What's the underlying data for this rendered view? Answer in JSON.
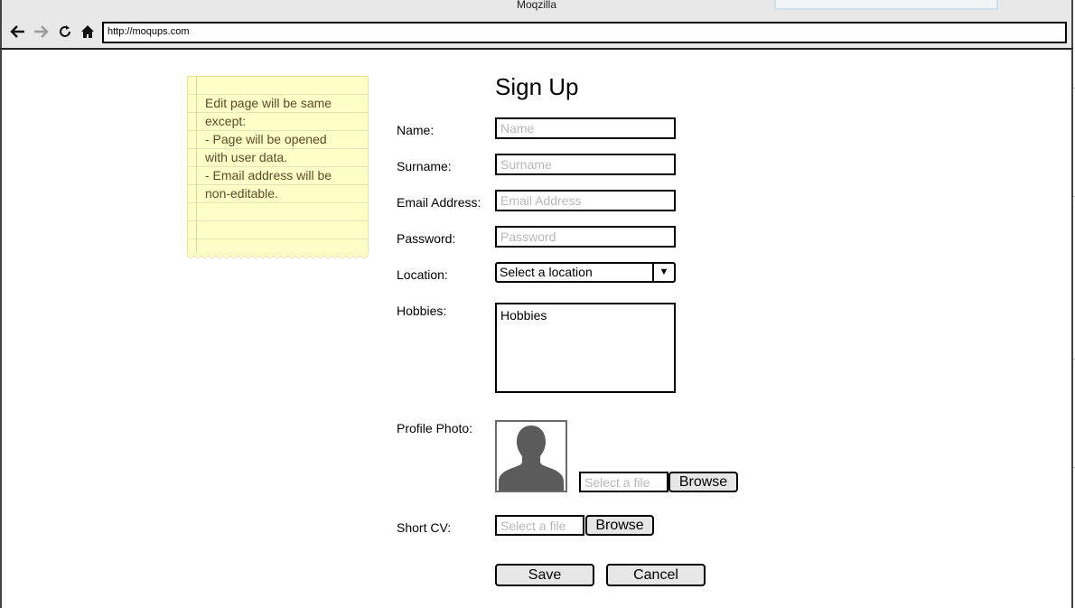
{
  "browser": {
    "window_title": "Moqzilla",
    "url": "http://moqups.com",
    "nav_icons": [
      "back-arrow-icon",
      "forward-arrow-icon",
      "reload-icon",
      "home-icon"
    ]
  },
  "note": {
    "lines": [
      "Edit page will be same",
      "except:",
      "- Page will be opened",
      "with user data.",
      "- Email address will be",
      "non-editable."
    ]
  },
  "form": {
    "title": "Sign Up",
    "name": {
      "label": "Name:",
      "placeholder": "Name"
    },
    "surname": {
      "label": "Surname:",
      "placeholder": "Surname"
    },
    "email": {
      "label": "Email Address:",
      "placeholder": "Email Address"
    },
    "password": {
      "label": "Password:",
      "placeholder": "Password"
    },
    "location": {
      "label": "Location:",
      "selected": "Select a location"
    },
    "hobbies": {
      "label": "Hobbies:",
      "value": "Hobbies"
    },
    "profile_photo": {
      "label": "Profile Photo:",
      "file_placeholder": "Select a file",
      "browse_label": "Browse"
    },
    "short_cv": {
      "label": "Short CV:",
      "file_placeholder": "Select a file",
      "browse_label": "Browse"
    },
    "save_label": "Save",
    "cancel_label": "Cancel"
  }
}
